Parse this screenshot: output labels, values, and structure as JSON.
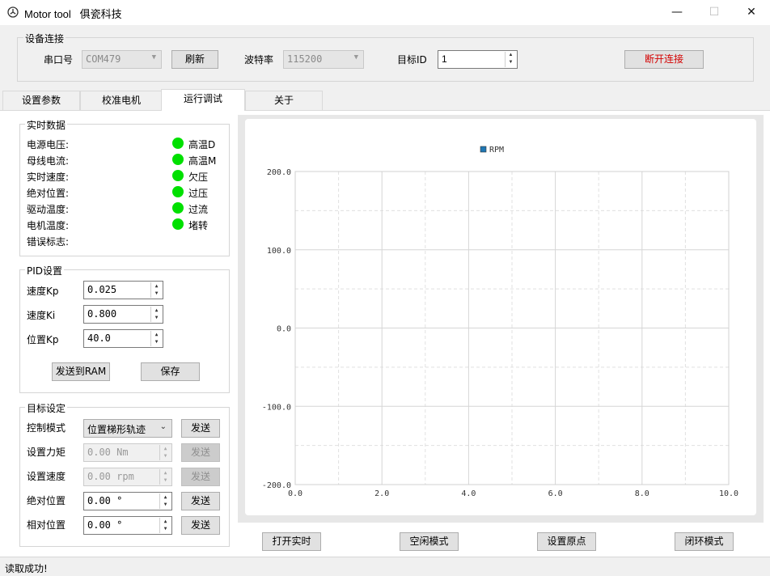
{
  "window": {
    "app_name": "Motor tool",
    "vendor": "俱瓷科技",
    "minimize": "—",
    "maximize": "☐",
    "close": "✕"
  },
  "connection": {
    "group_title": "设备连接",
    "port_label": "串口号",
    "port_value": "COM479",
    "refresh_label": "刷新",
    "baud_label": "波特率",
    "baud_value": "115200",
    "target_id_label": "目标ID",
    "target_id_value": "1",
    "disconnect_label": "断开连接",
    "disconnect_color": "#d40000"
  },
  "tabs": [
    {
      "label": "设置参数"
    },
    {
      "label": "校准电机"
    },
    {
      "label": "运行调试"
    },
    {
      "label": "关于"
    }
  ],
  "realtime": {
    "group_title": "实时数据",
    "rows": [
      {
        "label": "电源电压:"
      },
      {
        "label": "母线电流:"
      },
      {
        "label": "实时速度:"
      },
      {
        "label": "绝对位置:"
      },
      {
        "label": "驱动温度:"
      },
      {
        "label": "电机温度:"
      },
      {
        "label": "错误标志:"
      }
    ],
    "flags": [
      {
        "label": "高温D",
        "color": "#00e000"
      },
      {
        "label": "高温M",
        "color": "#00e000"
      },
      {
        "label": "欠压",
        "color": "#00e000"
      },
      {
        "label": "过压",
        "color": "#00e000"
      },
      {
        "label": "过流",
        "color": "#00e000"
      },
      {
        "label": "堵转",
        "color": "#00e000"
      }
    ]
  },
  "pid": {
    "group_title": "PID设置",
    "speed_kp_label": "速度Kp",
    "speed_kp_value": "0.025",
    "speed_ki_label": "速度Ki",
    "speed_ki_value": "0.800",
    "pos_kp_label": "位置Kp",
    "pos_kp_value": "40.0",
    "send_ram_label": "发送到RAM",
    "save_label": "保存"
  },
  "target": {
    "group_title": "目标设定",
    "mode_label": "控制模式",
    "mode_value": "位置梯形轨迹",
    "torque_label": "设置力矩",
    "torque_value": "0.00 Nm",
    "speed_label": "设置速度",
    "speed_value": "0.00 rpm",
    "abs_pos_label": "绝对位置",
    "abs_pos_value": "0.00 °",
    "rel_pos_label": "相对位置",
    "rel_pos_value": "0.00 °",
    "send_label": "发送"
  },
  "bottom_buttons": {
    "realtime": "打开实时",
    "idle": "空闲模式",
    "origin": "设置原点",
    "closed_loop": "闭环模式"
  },
  "status": {
    "text": "读取成功!"
  },
  "chart_data": {
    "type": "line",
    "series": [
      {
        "name": "RPM",
        "color": "#1f77b4",
        "x": [],
        "y": []
      }
    ],
    "legend": "top-center",
    "xlim": [
      0.0,
      10.0
    ],
    "ylim": [
      -200.0,
      200.0
    ],
    "xticks": [
      "0.0",
      "2.0",
      "4.0",
      "6.0",
      "8.0",
      "10.0"
    ],
    "yticks": [
      "200.0",
      "100.0",
      "0.0",
      "-100.0",
      "-200.0"
    ],
    "grid": true
  }
}
